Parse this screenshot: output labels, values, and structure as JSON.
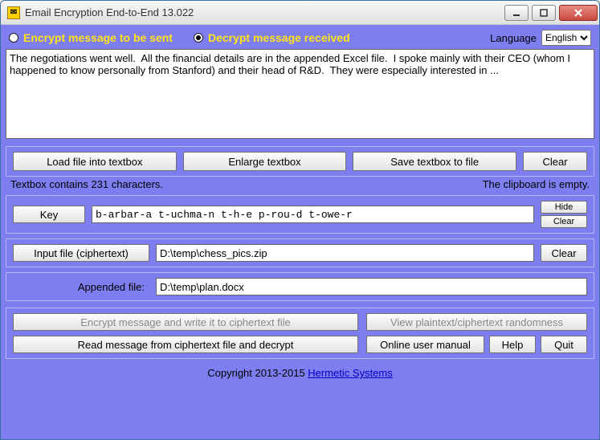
{
  "window": {
    "title": "Email Encryption End-to-End 13.022",
    "icon_glyph": "✉"
  },
  "mode": {
    "encrypt_label": "Encrypt message to be sent",
    "decrypt_label": "Decrypt message received",
    "selected": "decrypt"
  },
  "language": {
    "label": "Language",
    "value": "English",
    "options": [
      "English"
    ]
  },
  "message": {
    "text": "The negotiations went well.  All the financial details are in the appended Excel file.  I spoke mainly with their CEO (whom I happened to know personally from Stanford) and their head of R&D.  They were especially interested in ..."
  },
  "textbox_actions": {
    "load": "Load file into textbox",
    "enlarge": "Enlarge textbox",
    "save": "Save textbox to file",
    "clear": "Clear"
  },
  "status": {
    "left": "Textbox contains 231 characters.",
    "right": "The clipboard is empty."
  },
  "key": {
    "button": "Key",
    "value": "b-arbar-a t-uchma-n t-h-e p-rou-d t-owe-r",
    "hide": "Hide",
    "clear": "Clear"
  },
  "input_file": {
    "label": "Input file (ciphertext)",
    "value": "D:\\temp\\chess_pics.zip",
    "clear": "Clear"
  },
  "appended_file": {
    "label": "Appended file:",
    "value": "D:\\temp\\plan.docx"
  },
  "actions": {
    "encrypt_write": "Encrypt message and write it to ciphertext file",
    "view_random": "View plaintext/ciphertext randomness",
    "read_decrypt": "Read message from ciphertext file and decrypt",
    "manual": "Online user manual",
    "help": "Help",
    "quit": "Quit"
  },
  "footer": {
    "copyright": "Copyright 2013-2015  ",
    "link_text": "Hermetic Systems"
  }
}
